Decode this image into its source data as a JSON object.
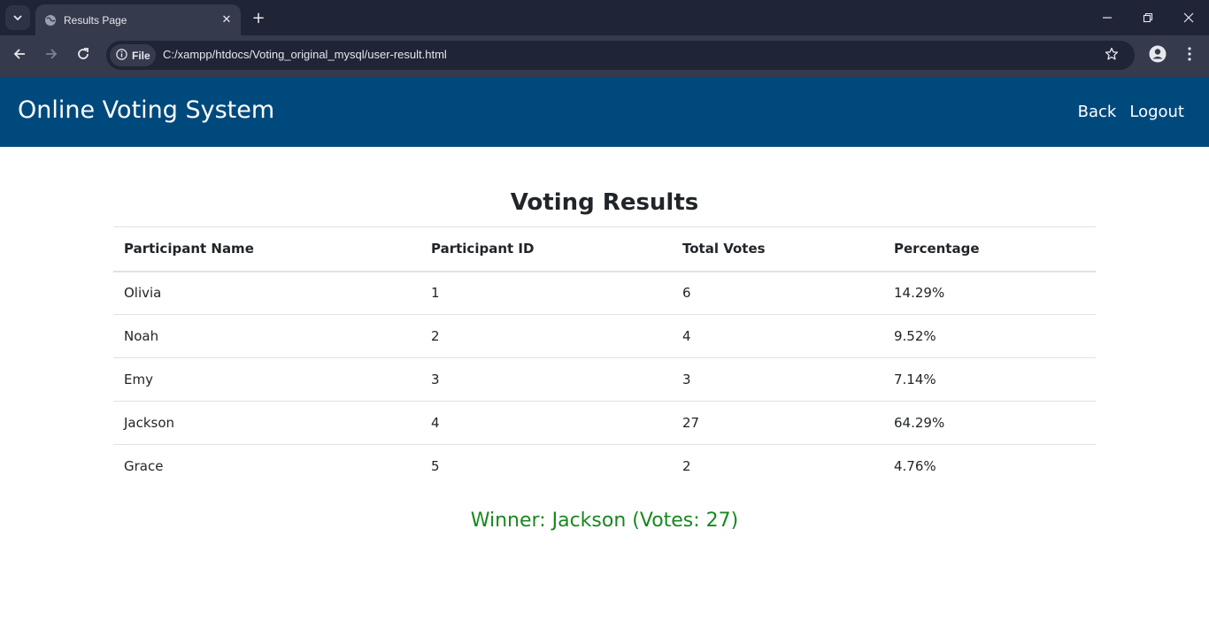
{
  "browser": {
    "tab_title": "Results Page",
    "new_tab_symbol": "+",
    "close_symbol": "✕",
    "site_chip_label": "File",
    "url": "C:/xampp/htdocs/Voting_original_mysql/user-result.html"
  },
  "navbar": {
    "brand": "Online Voting System",
    "links": [
      {
        "label": "Back"
      },
      {
        "label": "Logout"
      }
    ],
    "background_color": "#00497d"
  },
  "results": {
    "title": "Voting Results",
    "columns": [
      "Participant Name",
      "Participant ID",
      "Total Votes",
      "Percentage"
    ],
    "rows": [
      {
        "name": "Olivia",
        "id": "1",
        "votes": "6",
        "percentage": "14.29%"
      },
      {
        "name": "Noah",
        "id": "2",
        "votes": "4",
        "percentage": "9.52%"
      },
      {
        "name": "Emy",
        "id": "3",
        "votes": "3",
        "percentage": "7.14%"
      },
      {
        "name": "Jackson",
        "id": "4",
        "votes": "27",
        "percentage": "64.29%"
      },
      {
        "name": "Grace",
        "id": "5",
        "votes": "2",
        "percentage": "4.76%"
      }
    ]
  },
  "winner": {
    "text": "Winner: Jackson (Votes: 27)",
    "color": "#18881e"
  }
}
